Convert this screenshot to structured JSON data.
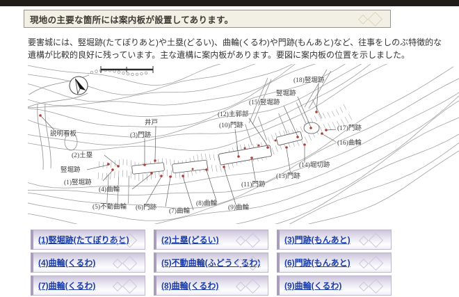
{
  "header": {
    "title": "現地の主要な箇所には案内板が設置してあります。"
  },
  "intro": {
    "text": "要害城には、竪堀跡(たてぼりあと)や土塁(どるい)、曲輪(くるわ)や門跡(もんあと)など、往事をしのぶ特徴的な遺構が比較的良好に残っています。主な遺構に案内板があります。要図に案内板の位置を示しました。"
  },
  "map": {
    "marker_color": "#b23b32",
    "compass_icon": "north-arrow-icon",
    "labels": [
      {
        "text": "説明看板"
      },
      {
        "text": "竪堀跡"
      },
      {
        "text": "(1)竪堀跡"
      },
      {
        "text": "(2)土塁"
      },
      {
        "text": "(3)門跡"
      },
      {
        "text": "井戸"
      },
      {
        "text": "(4)曲輪"
      },
      {
        "text": "(5)不動曲輪"
      },
      {
        "text": "(6)門跡"
      },
      {
        "text": "(7)曲輪"
      },
      {
        "text": "(8)曲輪"
      },
      {
        "text": "(9)曲輪"
      },
      {
        "text": "(10)門跡"
      },
      {
        "text": "(11)門跡"
      },
      {
        "text": "(12)主郭部"
      },
      {
        "text": "(13)門跡"
      },
      {
        "text": "(14)堀切跡"
      },
      {
        "text": "(15)竪堀跡"
      },
      {
        "text": "竪堀跡"
      },
      {
        "text": "(16)曲輪"
      },
      {
        "text": "(17)門跡"
      },
      {
        "text": "(18)竪堀跡"
      }
    ]
  },
  "links": [
    {
      "label": "(1)竪堀跡(たてぼりあと)"
    },
    {
      "label": "(2)土塁(どるい)"
    },
    {
      "label": "(3)門跡(もんあと)"
    },
    {
      "label": "(4)曲輪(くるわ)"
    },
    {
      "label": "(5)不動曲輪(ふどうくるわ)"
    },
    {
      "label": "(6)門跡(もんあと)"
    },
    {
      "label": "(7)曲輪(くるわ)"
    },
    {
      "label": "(8)曲輪(くるわ)"
    },
    {
      "label": "(9)曲輪(くるわ)"
    }
  ]
}
